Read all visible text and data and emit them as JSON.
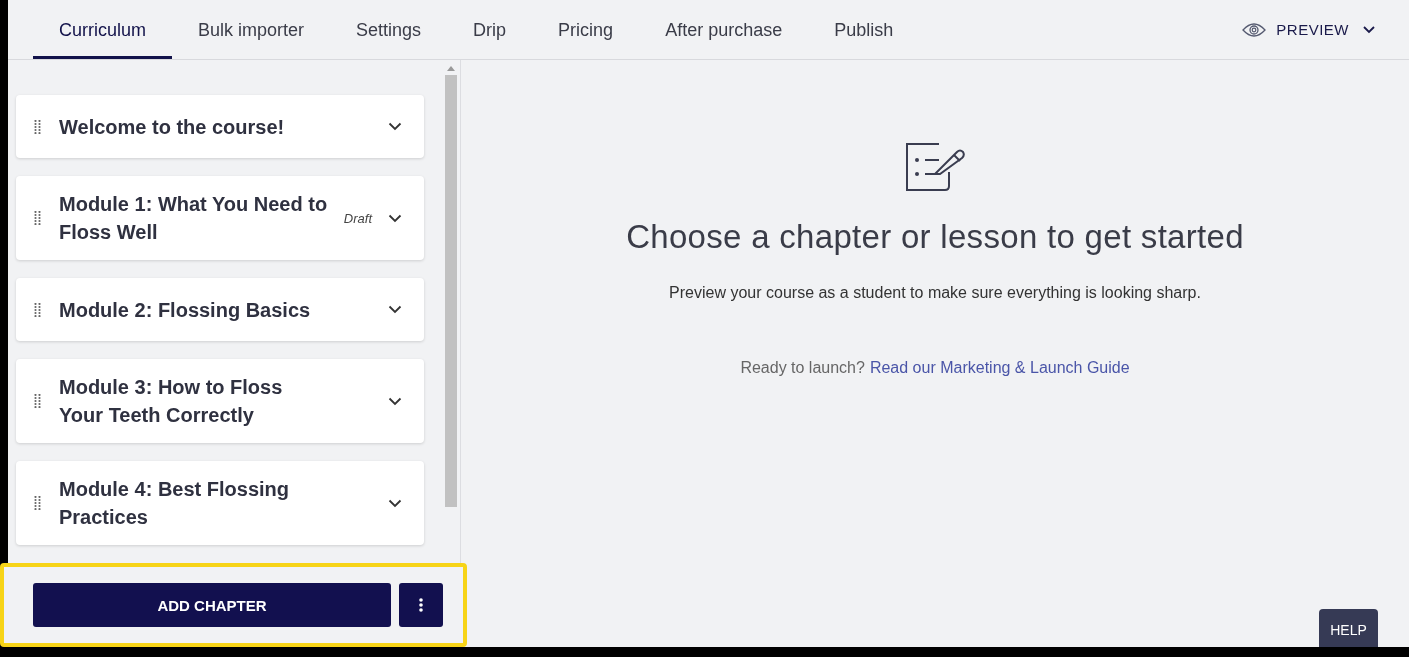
{
  "tabs": [
    {
      "label": "Curriculum",
      "selected": true
    },
    {
      "label": "Bulk importer",
      "selected": false
    },
    {
      "label": "Settings",
      "selected": false
    },
    {
      "label": "Drip",
      "selected": false
    },
    {
      "label": "Pricing",
      "selected": false
    },
    {
      "label": "After purchase",
      "selected": false
    },
    {
      "label": "Publish",
      "selected": false
    }
  ],
  "preview_button": {
    "label": "PREVIEW"
  },
  "chapters": [
    {
      "title": "Welcome to the course!"
    },
    {
      "title": "Module 1: What You Need to Floss Well",
      "status": "Draft"
    },
    {
      "title": "Module 2: Flossing Basics"
    },
    {
      "title": "Module 3: How to Floss Your Teeth Correctly"
    },
    {
      "title": "Module 4: Best Flossing Practices"
    }
  ],
  "add_chapter_button": {
    "label": "ADD CHAPTER"
  },
  "empty_state": {
    "heading": "Choose a chapter or lesson to get started",
    "description": "Preview your course as a student to make sure everything is looking sharp.",
    "launch_prompt": "Ready to launch?",
    "launch_link": "Read our Marketing & Launch Guide"
  },
  "help_button": {
    "label": "HELP"
  }
}
